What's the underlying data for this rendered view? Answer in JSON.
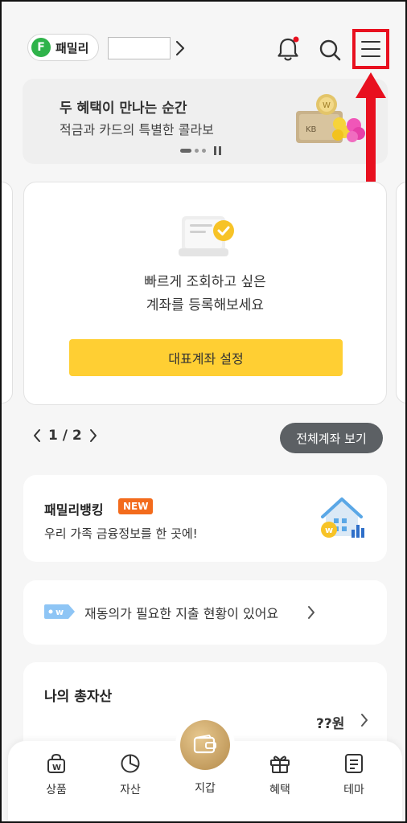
{
  "header": {
    "family_badge_letter": "F",
    "family_label": "패밀리",
    "name_value": "",
    "bell_dot_color": "#e8101f"
  },
  "banner": {
    "title": "두 혜택이 만나는 순간",
    "subtitle": "적금과 카드의 특별한 콜라보",
    "art_text": "KB"
  },
  "account_card": {
    "message_line1": "빠르게 조회하고 싶은",
    "message_line2": "계좌를 등록해보세요",
    "set_button": "대표계좌 설정"
  },
  "pager": {
    "current": "1",
    "separator": "/",
    "total": "2",
    "all_accounts_button": "전체계좌 보기"
  },
  "family_banking": {
    "title": "패밀리뱅킹",
    "badge": "NEW",
    "subtitle": "우리 가족 금융정보를 한 곳에!"
  },
  "consent": {
    "text": "재동의가 필요한 지출 현황이 있어요"
  },
  "assets": {
    "title": "나의 총자산",
    "value": "??원"
  },
  "bottom_nav": {
    "items": [
      {
        "label": "상품",
        "icon": "shopping-bag-icon"
      },
      {
        "label": "자산",
        "icon": "pie-chart-icon"
      },
      {
        "label": "지갑",
        "icon": "wallet-icon"
      },
      {
        "label": "혜택",
        "icon": "gift-icon"
      },
      {
        "label": "테마",
        "icon": "document-icon"
      }
    ]
  },
  "colors": {
    "accent_yellow": "#ffcf33",
    "annotation_red": "#e8101f",
    "new_badge": "#f36b1c",
    "family_green": "#2fb34a"
  }
}
